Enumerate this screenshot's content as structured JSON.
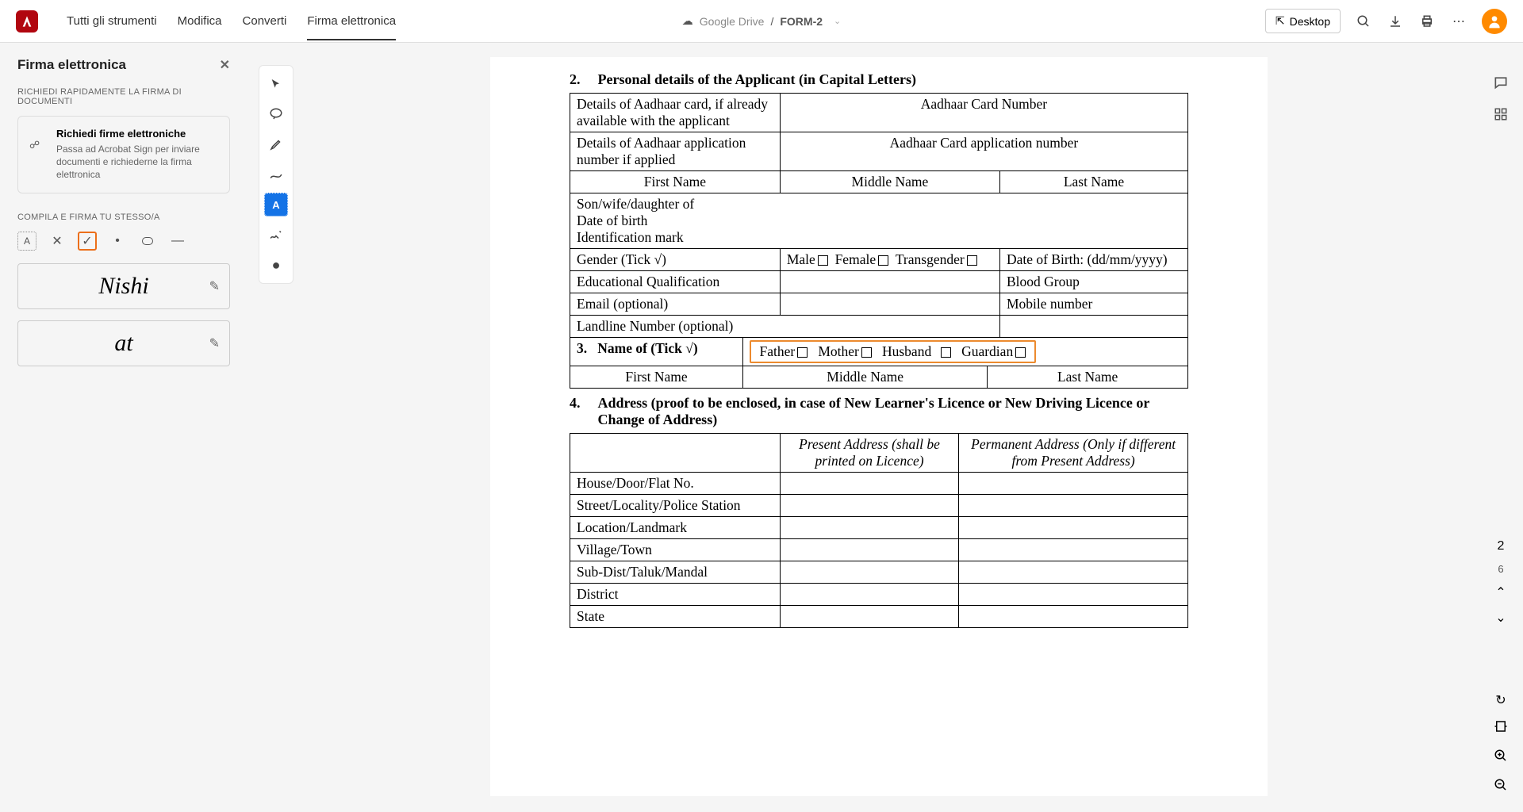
{
  "topnav": {
    "tools": "Tutti gli strumenti",
    "edit": "Modifica",
    "convert": "Converti",
    "sign": "Firma elettronica"
  },
  "doc": {
    "cloud": "Google Drive",
    "sep": "/",
    "name": "FORM-2"
  },
  "desktop": "Desktop",
  "sidebar": {
    "title": "Firma elettronica",
    "sub1": "RICHIEDI RAPIDAMENTE LA FIRMA DI DOCUMENTI",
    "card_title": "Richiedi firme elettroniche",
    "card_desc": "Passa ad Acrobat Sign per inviare documenti e richiederne la firma elettronica",
    "sub2": "COMPILA E FIRMA TU STESSO/A",
    "sig1": "Nishi",
    "sig2": "at"
  },
  "form": {
    "sec2_num": "2.",
    "sec2_title": "Personal details of the Applicant (in Capital Letters)",
    "r1a": "Details of Aadhaar card, if already available with the applicant",
    "r1b": "Aadhaar Card Number",
    "r2a": "Details of Aadhaar application number if applied",
    "r2b": "Aadhaar Card application number",
    "fn": "First Name",
    "mn": "Middle Name",
    "ln": "Last Name",
    "son": "Son/wife/daughter of",
    "dob": "Date of birth",
    "idmark": "Identification mark",
    "gender": "Gender (Tick √)",
    "male": "Male",
    "female": "Female",
    "trans": "Transgender",
    "dob2": "Date of Birth: (dd/mm/yyyy)",
    "edu": "Educational Qualification",
    "blood": "Blood Group",
    "email": "Email (optional)",
    "mobile": "Mobile number",
    "landline": "Landline Number (optional)",
    "sec3_num": "3.",
    "sec3_title": "Name of (Tick √)",
    "father": "Father",
    "mother": "Mother",
    "husband": "Husband",
    "guardian": "Guardian",
    "sec4_num": "4.",
    "sec4_title": "Address (proof to be enclosed, in case of New Learner's Licence or New Driving Licence or Change of Address)",
    "present": "Present Address (shall be printed on Licence)",
    "permanent": "Permanent Address (Only if different from Present Address)",
    "house": "House/Door/Flat No.",
    "street": "Street/Locality/Police Station",
    "loc": "Location/Landmark",
    "village": "Village/Town",
    "subdist": "Sub-Dist/Taluk/Mandal",
    "district": "District",
    "state": "State"
  },
  "pager": {
    "cur": "2",
    "total": "6"
  }
}
